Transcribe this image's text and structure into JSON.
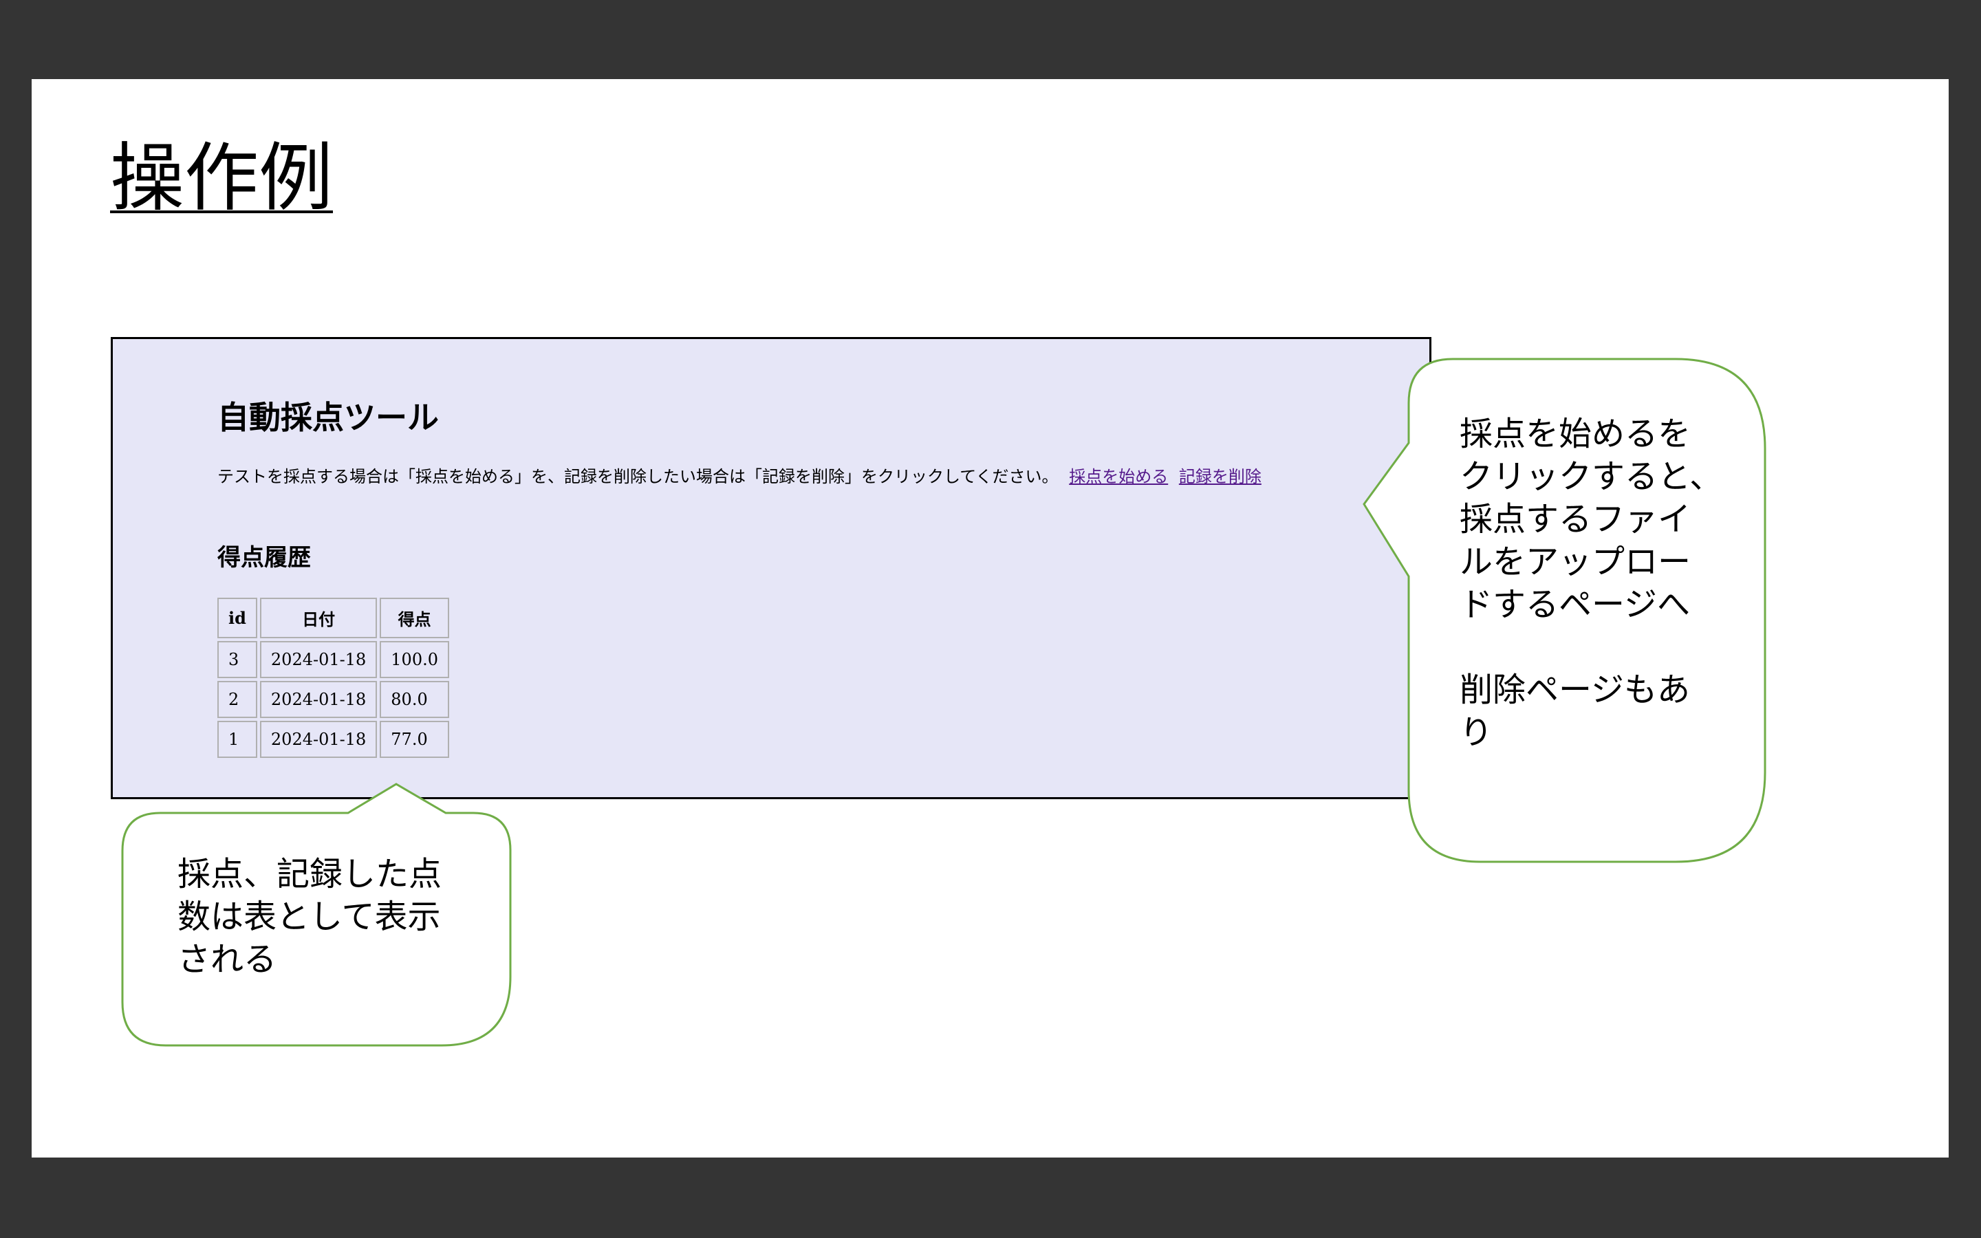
{
  "slide": {
    "title": "操作例"
  },
  "app": {
    "title": "自動採点ツール",
    "instructions": "テストを採点する場合は「採点を始める」を、記録を削除したい場合は「記録を削除」をクリックしてください。",
    "links": {
      "start": "採点を始める",
      "delete": "記録を削除"
    },
    "history_title": "得点履歴",
    "table": {
      "headers": [
        "id",
        "日付",
        "得点"
      ],
      "rows": [
        [
          "3",
          "2024-01-18",
          "100.0"
        ],
        [
          "2",
          "2024-01-18",
          "80.0"
        ],
        [
          "1",
          "2024-01-18",
          "77.0"
        ]
      ]
    }
  },
  "callouts": {
    "right": "採点を始めるを\nクリックすると、\n採点するファイ\nルをアップロー\nドするページへ\n\n削除ページもあ\nり",
    "bottom": "採点、記録した点\n数は表として表示\nされる"
  },
  "colors": {
    "background": "#343434",
    "panel": "#e6e6f7",
    "callout_border": "#70ad47",
    "link": "#551a8b"
  }
}
